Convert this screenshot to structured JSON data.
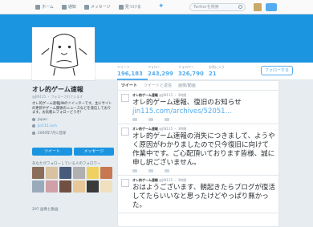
{
  "nav": {
    "items": [
      {
        "label": "ホーム",
        "icon": "home-icon"
      },
      {
        "label": "通知",
        "icon": "bell-icon"
      },
      {
        "label": "メッセージ",
        "icon": "mail-icon"
      },
      {
        "label": "見つける",
        "icon": "hashtag-icon"
      }
    ],
    "search_placeholder": "Twitterを検索"
  },
  "stats": [
    {
      "label": "ツイート",
      "value": "196,183"
    },
    {
      "label": "フォロー",
      "value": "243,299"
    },
    {
      "label": "フォロワー",
      "value": "326,790"
    },
    {
      "label": "お気に入り",
      "value": "21"
    }
  ],
  "follow_label": "フォローする",
  "profile": {
    "name": "オレ的ゲーム速報",
    "handle": "@JIN115 ・ フォローされています",
    "bio": "オレ的ゲーム速報JINのツイッターです。主にサイトの更新やゲーム関係のニュースなどを発信しております。お気軽にフォローどうぞ!",
    "location": "Japan",
    "url": "jin115.com",
    "joined": "2009年7月に登録",
    "button1": "ツイート",
    "button2": "メッセージ"
  },
  "followers_title": "あなたがフォローしている人のフォロワー",
  "photos_title": "297 画像と動画",
  "tabs": [
    "ツイート",
    "ツイートと返信",
    "画像/動画"
  ],
  "tweets": [
    {
      "name": "オレ的ゲーム速報",
      "meta": "@JIN115 ・ 3時間",
      "text": "オレ的ゲーム速報、復旧のお知らせ",
      "link": "jin115.com/archives/52051..."
    },
    {
      "name": "オレ的ゲーム速報",
      "meta": "@JIN115 ・ 3時間",
      "text": "オレ的ゲーム速報の消失につきまして、ようやく原因がわかりましたので只今復旧に向けて作業中です。ご心配頂いております皆様、誠に申し訳ございません。",
      "link": ""
    },
    {
      "name": "オレ的ゲーム速報",
      "meta": "@JIN115 ・ 3時間",
      "text": "おはようございます、朝起きたらブログが復活してたらいいなと思ったけどやっぱり無かった。",
      "link": ""
    }
  ]
}
